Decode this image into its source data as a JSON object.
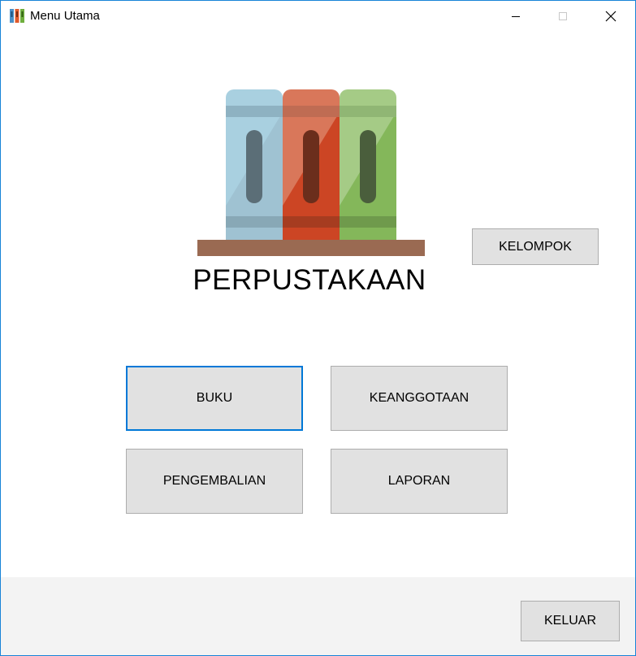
{
  "window": {
    "title": "Menu Utama",
    "border_color": "#1883d7"
  },
  "titlebar": {
    "app_icon": "books-icon",
    "minimize_icon": "minimize-icon",
    "maximize_icon": "maximize-icon",
    "close_icon": "close-icon"
  },
  "logo": {
    "icon": "library-books-icon",
    "colors": {
      "book1": "#a9d0e0",
      "book2": "#d9532f",
      "book3": "#8ac060",
      "shelf": "#9a6a52"
    }
  },
  "brand": {
    "title": "PERPUSTAKAAN"
  },
  "buttons": {
    "kelompok": "KELOMPOK",
    "buku": "BUKU",
    "keanggotaan": "KEANGGOTAAN",
    "pengembalian": "PENGEMBALIAN",
    "laporan": "LAPORAN",
    "keluar": "KELUAR"
  },
  "accent_color": "#0078d7"
}
